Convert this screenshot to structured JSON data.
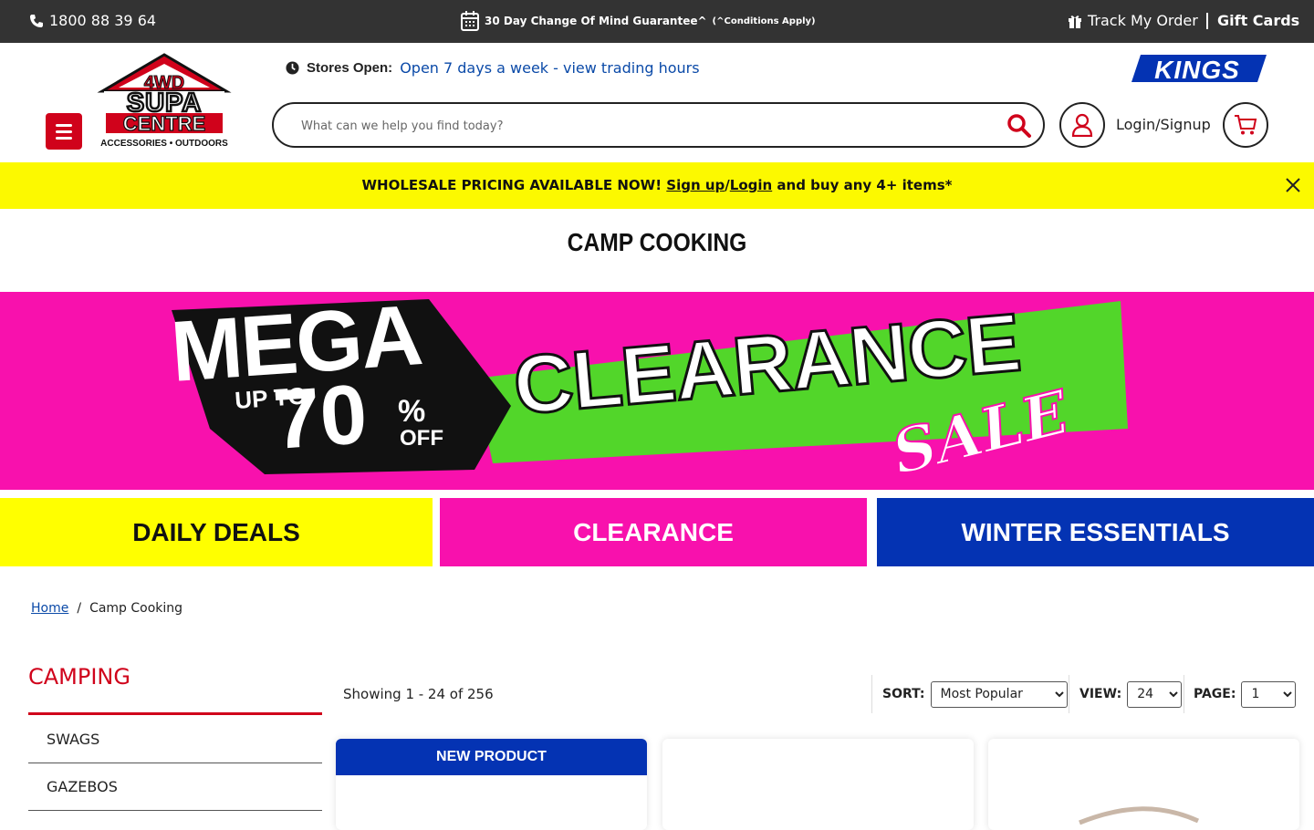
{
  "topbar": {
    "phone": "1800 88 39 64",
    "guarantee": "30 Day Change Of Mind Guarantee^",
    "guarantee_note": "(^Conditions Apply)",
    "track": "Track My Order",
    "gift": "Gift Cards"
  },
  "header": {
    "logo_line1": "4WD",
    "logo_line2": "SUPA",
    "logo_line3": "CENTRE",
    "logo_tagline": "ACCESSORIES • OUTDOORS",
    "brand_logo": "KINGS",
    "stores_label": "Stores Open:",
    "stores_link": "Open 7 days a week - view trading hours",
    "search_placeholder": "What can we help you find today?",
    "login": "Login/Signup"
  },
  "promo": {
    "text_before": "WHOLESALE PRICING AVAILABLE NOW! ",
    "signup": "Sign up",
    "slash": "/",
    "login": "Login",
    "text_after": " and buy any 4+ items*"
  },
  "page_title": "CAMP COOKING",
  "hero": {
    "mega": "MEGA",
    "up_to": "UP TO",
    "percent": "70",
    "percent_sign": "%",
    "off": "OFF",
    "clearance": "CLEARANCE",
    "sale": "SALE"
  },
  "tiles": {
    "deals": "DAILY DEALS",
    "clearance": "CLEARANCE",
    "winter": "WINTER ESSENTIALS"
  },
  "breadcrumb": {
    "home": "Home",
    "sep": "/",
    "current": "Camp Cooking"
  },
  "sidebar": {
    "title": "CAMPING",
    "items": [
      {
        "label": "SWAGS"
      },
      {
        "label": "GAZEBOS"
      }
    ]
  },
  "listing": {
    "showing": "Showing 1 - 24 of 256",
    "sort_label": "SORT:",
    "sort_value": "Most Popular",
    "view_label": "VIEW:",
    "view_value": "24",
    "page_label": "PAGE:",
    "page_value": "1"
  },
  "cards": [
    {
      "badge": "NEW PRODUCT"
    }
  ],
  "colors": {
    "topbar": "#333333",
    "brand_red": "#d0021b",
    "promo_yellow": "#fcf900",
    "hero_pink": "#f811ad",
    "hero_green": "#52d62a",
    "winter_blue": "#0433b3",
    "link_blue": "#0b4aa8"
  },
  "icons": [
    "phone-icon",
    "calendar-icon",
    "gift-icon",
    "clock-icon",
    "menu-icon",
    "search-icon",
    "user-icon",
    "cart-icon",
    "close-icon"
  ]
}
